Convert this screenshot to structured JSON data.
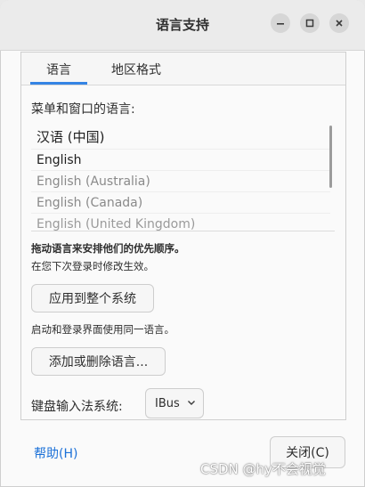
{
  "window": {
    "title": "语言支持"
  },
  "tabs": [
    {
      "label": "语言"
    },
    {
      "label": "地区格式"
    }
  ],
  "language_section": {
    "label": "菜单和窗口的语言:",
    "languages": [
      "汉语 (中国)",
      "English",
      "English (Australia)",
      "English (Canada)",
      "English (United Kingdom)"
    ],
    "drag_hint_bold": "拖动语言来安排他们的优先顺序。",
    "drag_hint": "在您下次登录时修改生效。",
    "apply_button": "应用到整个系统",
    "apply_hint": "启动和登录界面使用同一语言。",
    "add_remove_button": "添加或删除语言..."
  },
  "keyboard": {
    "label": "键盘输入法系统:",
    "selected": "IBus"
  },
  "footer": {
    "help": "帮助(H)",
    "close": "关闭(C)"
  },
  "watermark": "CSDN @hy不会视觉",
  "colors": {
    "accent": "#3584e4",
    "link": "#1c71d8"
  }
}
